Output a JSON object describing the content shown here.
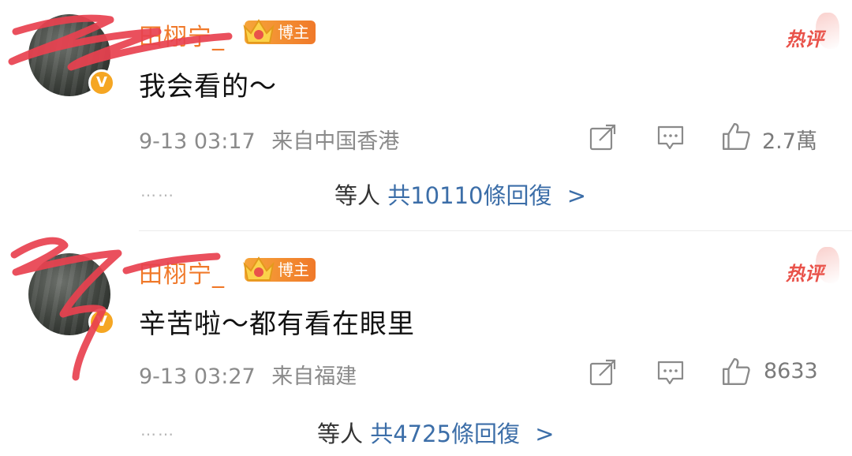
{
  "comments": [
    {
      "username": "田栩宁_",
      "badge_label": "博主",
      "hot_label": "热评",
      "text": "我会看的～",
      "time": "9-13 03:17",
      "location": "来自中国香港",
      "likes": "2.7萬",
      "reply_prefix": "等人",
      "reply_count": "共10110條回復",
      "reply_arrow": ">",
      "dots": "……"
    },
    {
      "username": "田栩宁_",
      "badge_label": "博主",
      "hot_label": "热评",
      "text": "辛苦啦～都有看在眼里",
      "time": "9-13 03:27",
      "location": "来自福建",
      "likes": "8633",
      "reply_prefix": "等人",
      "reply_count": "共4725條回復",
      "reply_arrow": ">",
      "dots": "……"
    }
  ],
  "colors": {
    "username": "#f0792a",
    "hot": "#e9524a",
    "reply_link": "#3c6ea8",
    "meta": "#8a8a8a",
    "scribble": "#e8414f"
  },
  "icons": {
    "verified": "v-badge-icon",
    "share": "share-icon",
    "comment": "comment-icon",
    "like": "thumbs-up-icon",
    "crown": "crown-icon"
  },
  "verified_glyph": "V"
}
